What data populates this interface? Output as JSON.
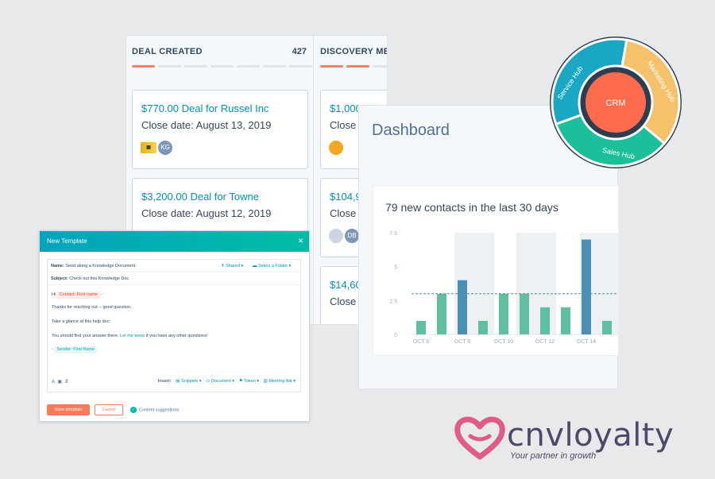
{
  "pipeline": {
    "columns": [
      {
        "title": "DEAL CREATED",
        "count": "427"
      },
      {
        "title": "DISCOVERY MEE",
        "count": ""
      }
    ],
    "deals": [
      {
        "title": "$770.00 Deal for Russel Inc",
        "close": "Close date: August 13, 2019",
        "avatar": "KG"
      },
      {
        "title": "$3,200.00 Deal for Towne",
        "close": "Close date: August 12, 2019",
        "avatar": ""
      },
      {
        "title": "$1,000",
        "close": "Close",
        "avatar": ""
      },
      {
        "title": "$104,9",
        "close": "Close",
        "avatar": "DB"
      },
      {
        "title": "$14,60",
        "close": "Close",
        "avatar": ""
      }
    ]
  },
  "dashboard": {
    "title": "Dashboard",
    "card_title": "79 new contacts in the last 30 days"
  },
  "chart_data": {
    "type": "bar",
    "title": "79 new contacts in the last 30 days",
    "x_tick_labels": [
      "OCT 6",
      "OCT 8",
      "OCT 10",
      "OCT 12",
      "OCT 14"
    ],
    "y_ticks": [
      0,
      2.5,
      5,
      7.5
    ],
    "ylim": [
      0,
      7.5
    ],
    "values": [
      1,
      3,
      4,
      1,
      3,
      3,
      2,
      2,
      7,
      1
    ],
    "highlighted_indices": [
      2,
      8
    ],
    "average_line": 3,
    "colors": {
      "bar": "#5fbfa0",
      "highlight": "#4a90b5",
      "average": "#4a90b5",
      "shade": "#eef1f3"
    }
  },
  "hubs": {
    "center": "CRM",
    "service": "Service Hub",
    "marketing": "Marketing Hub",
    "sales": "Sales Hub",
    "colors": {
      "center": "#ff6b4d",
      "service": "#1aa7c4",
      "marketing": "#f5c26b",
      "sales": "#1bbf9a"
    }
  },
  "template_modal": {
    "title": "New Template",
    "close_glyph": "×",
    "name_label": "Name:",
    "name_value": "Send along a Knowledge Document",
    "shared": "Shared",
    "folder": "Select a Folder",
    "subject_label": "Subject:",
    "subject_value": "Check out this Knowledge Doc",
    "greeting": "Hi",
    "contact_token": "Contact: First name",
    "line1": "Thanks for reaching out -- good question.",
    "line2": "Take a glance at this help doc:",
    "line3_pre": "You should find your answer there.",
    "line3_link": "Let me know",
    "line3_post": "if you have any other questions!",
    "sender_dash": "-",
    "sender_token": "Sender: First Name",
    "insert_label": "Insert:",
    "insert_items": [
      "Snippets",
      "Document",
      "Token",
      "Meeting link"
    ],
    "save_button": "Save template",
    "cancel_button": "Cancel",
    "content_suggestions": "Content suggestions"
  },
  "brand": {
    "name": "cnvloyalty",
    "tagline": "Your partner in growth",
    "heart_color": "#e05b86"
  }
}
